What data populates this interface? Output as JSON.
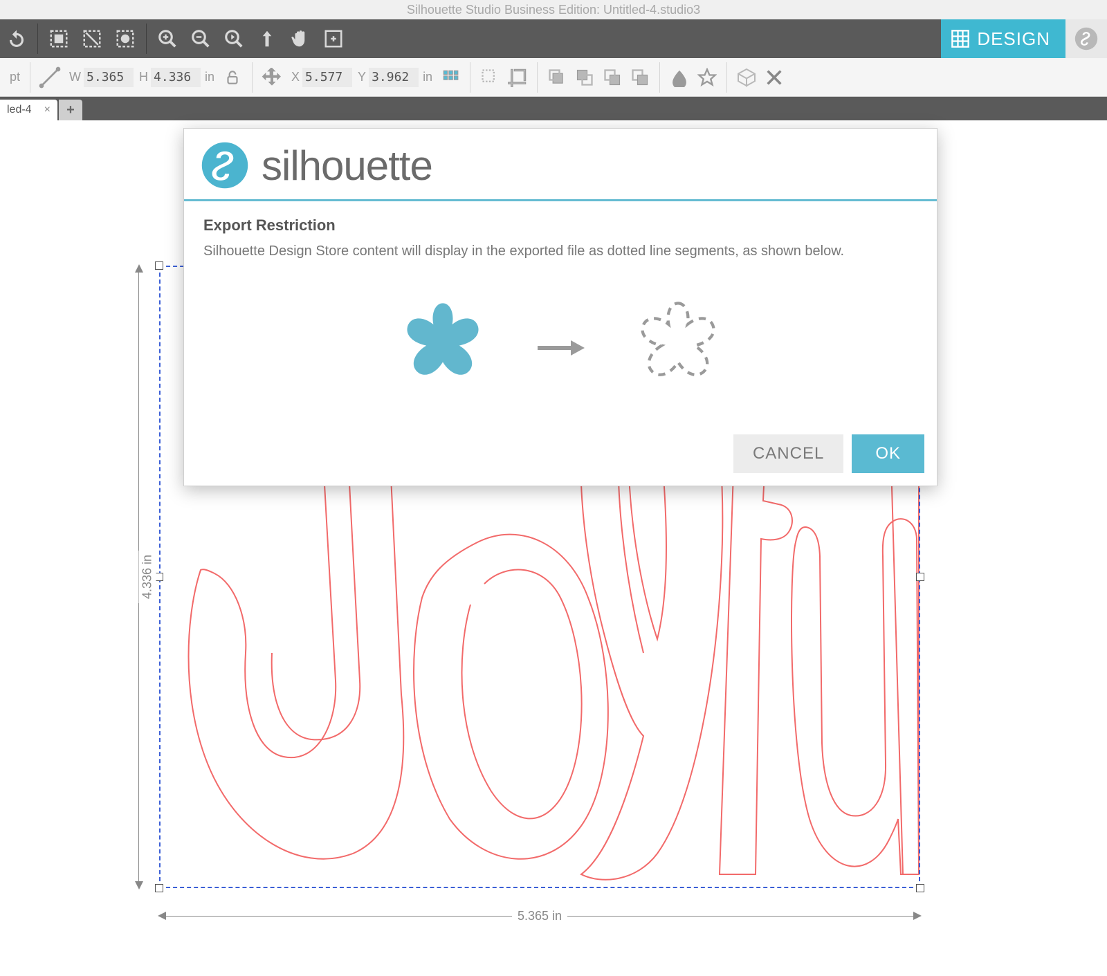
{
  "window": {
    "title": "Silhouette Studio Business Edition: Untitled-4.studio3"
  },
  "toolbar_main": {
    "design_label": "DESIGN"
  },
  "toolbar_sec": {
    "pt_label": "pt",
    "w_label": "W",
    "w_value": "5.365",
    "h_label": "H",
    "h_value": "4.336",
    "wh_unit": "in",
    "x_label": "X",
    "x_value": "5.577",
    "y_label": "Y",
    "y_value": "3.962",
    "xy_unit": "in"
  },
  "tabs": {
    "doc_name": "led-4",
    "close_glyph": "×",
    "add_glyph": "+"
  },
  "dimensions": {
    "v_label": "4.336 in",
    "h_label": "5.365 in"
  },
  "dialog": {
    "brand": "silhouette",
    "title": "Export Restriction",
    "body": "Silhouette Design Store content will display in the exported file as dotted line segments, as shown below.",
    "cancel": "CANCEL",
    "ok": "OK"
  }
}
